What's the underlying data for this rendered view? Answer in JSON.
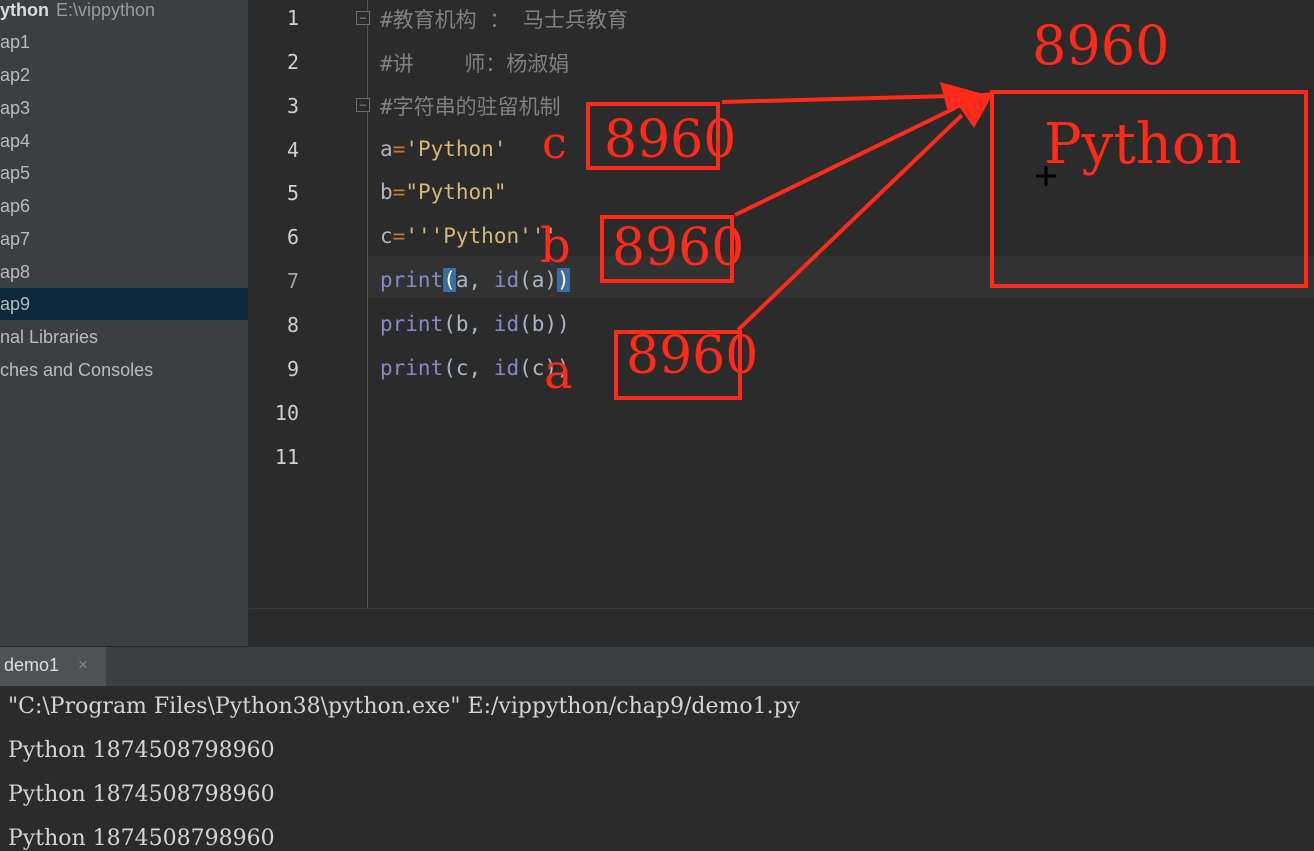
{
  "sidebar": {
    "root": {
      "label": "ython",
      "path": "E:\\vippython"
    },
    "items": [
      {
        "label": "ap1"
      },
      {
        "label": "ap2"
      },
      {
        "label": "ap3"
      },
      {
        "label": "ap4"
      },
      {
        "label": "ap5"
      },
      {
        "label": "ap6"
      },
      {
        "label": "ap7"
      },
      {
        "label": "ap8"
      },
      {
        "label": "ap9",
        "selected": true
      },
      {
        "label": "nal Libraries"
      },
      {
        "label": "ches and Consoles"
      }
    ]
  },
  "editor": {
    "line_numbers": [
      "1",
      "2",
      "3",
      "4",
      "5",
      "6",
      "7",
      "8",
      "9",
      "10",
      "11"
    ],
    "current_line": 7,
    "lines": {
      "l1": "#教育机构 ： 马士兵教育",
      "l2": "#讲    师：杨淑娟",
      "l3": "#字符串的驻留机制",
      "l4_var": "a",
      "l4_eq": "=",
      "l4_str": "'Python'",
      "l5_var": "b",
      "l5_eq": "=",
      "l5_str": "\"Python\"",
      "l6_var": "c",
      "l6_eq": "=",
      "l6_str": "'''Python'''",
      "l7_fn": "print",
      "l7_open": "(",
      "l7_args": "a, ",
      "l7_id": "id",
      "l7_inner": "(a)",
      "l7_close": ")",
      "l8_fn": "print",
      "l8_rest": "(b, ",
      "l8_id": "id",
      "l8_inner": "(b))",
      "l9_fn": "print",
      "l9_rest": "(c, ",
      "l9_id": "id",
      "l9_inner": "(c))"
    }
  },
  "run": {
    "tab_label": "demo1",
    "tab_close": "×",
    "output": [
      "\"C:\\Program Files\\Python38\\python.exe\" E:/vippython/chap9/demo1.py",
      "Python 1874508798960",
      "Python 1874508798960",
      "Python 1874508798960"
    ]
  },
  "annotations": {
    "memory_address": "8960",
    "memory_value": "Python",
    "ref_c": {
      "label": "c",
      "address": "8960"
    },
    "ref_b": {
      "label": "b",
      "address": "8960"
    },
    "ref_a": {
      "label": "a",
      "address": "8960"
    },
    "color": "#ff2a1a"
  }
}
